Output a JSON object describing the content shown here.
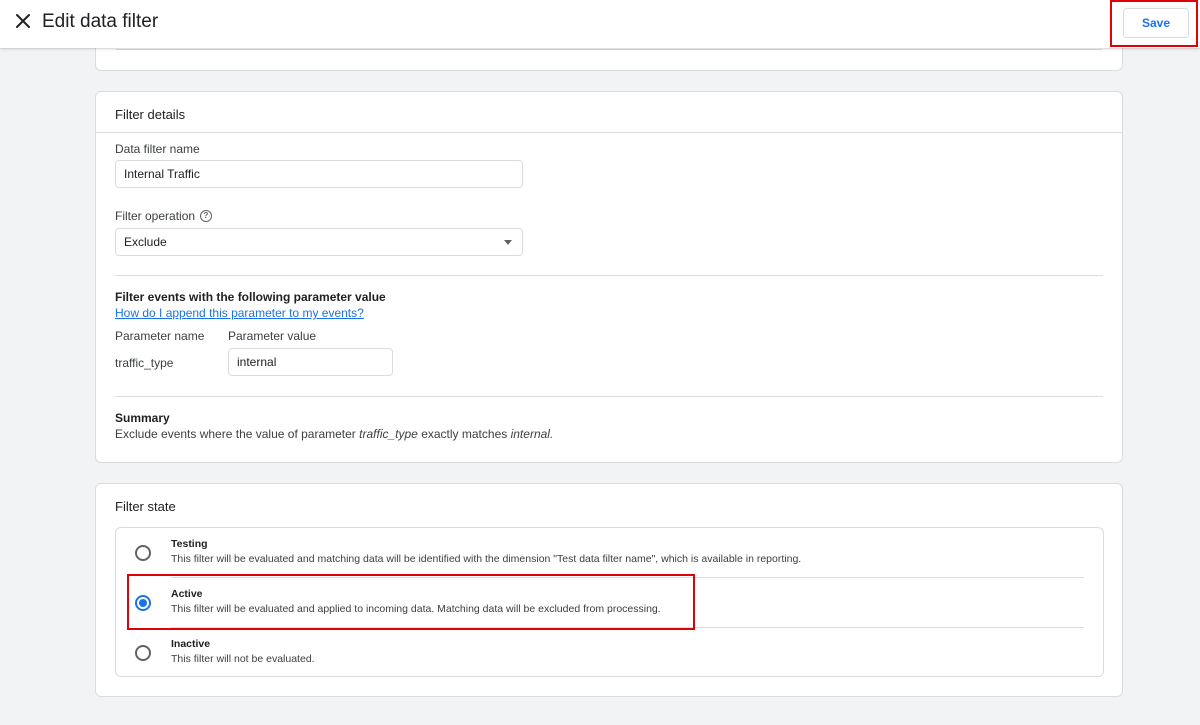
{
  "header": {
    "title": "Edit data filter",
    "save_label": "Save",
    "close_icon": "close-icon"
  },
  "filter_details": {
    "section_title": "Filter details",
    "name_label": "Data filter name",
    "name_value": "Internal Traffic",
    "operation_label": "Filter operation",
    "operation_help_icon": "help-circle-icon",
    "operation_value": "Exclude",
    "param_section_title": "Filter events with the following parameter value",
    "param_help_link": "How do I append this parameter to my events?",
    "param_name_header": "Parameter name",
    "param_value_header": "Parameter value",
    "param_name": "traffic_type",
    "param_value": "internal",
    "summary_title": "Summary",
    "summary_prefix": "Exclude events where the value of parameter",
    "summary_param": "traffic_type",
    "summary_middle": "exactly matches",
    "summary_value": "internal."
  },
  "filter_state": {
    "section_title": "Filter state",
    "selected": "Active",
    "options": [
      {
        "title": "Testing",
        "description": "This filter will be evaluated and matching data will be identified with the dimension \"Test data filter name\", which is available in reporting."
      },
      {
        "title": "Active",
        "description": "This filter will be evaluated and applied to incoming data. Matching data will be excluded from processing."
      },
      {
        "title": "Inactive",
        "description": "This filter will not be evaluated."
      }
    ]
  },
  "colors": {
    "accent": "#1a73e8",
    "highlight": "#e0000a"
  }
}
